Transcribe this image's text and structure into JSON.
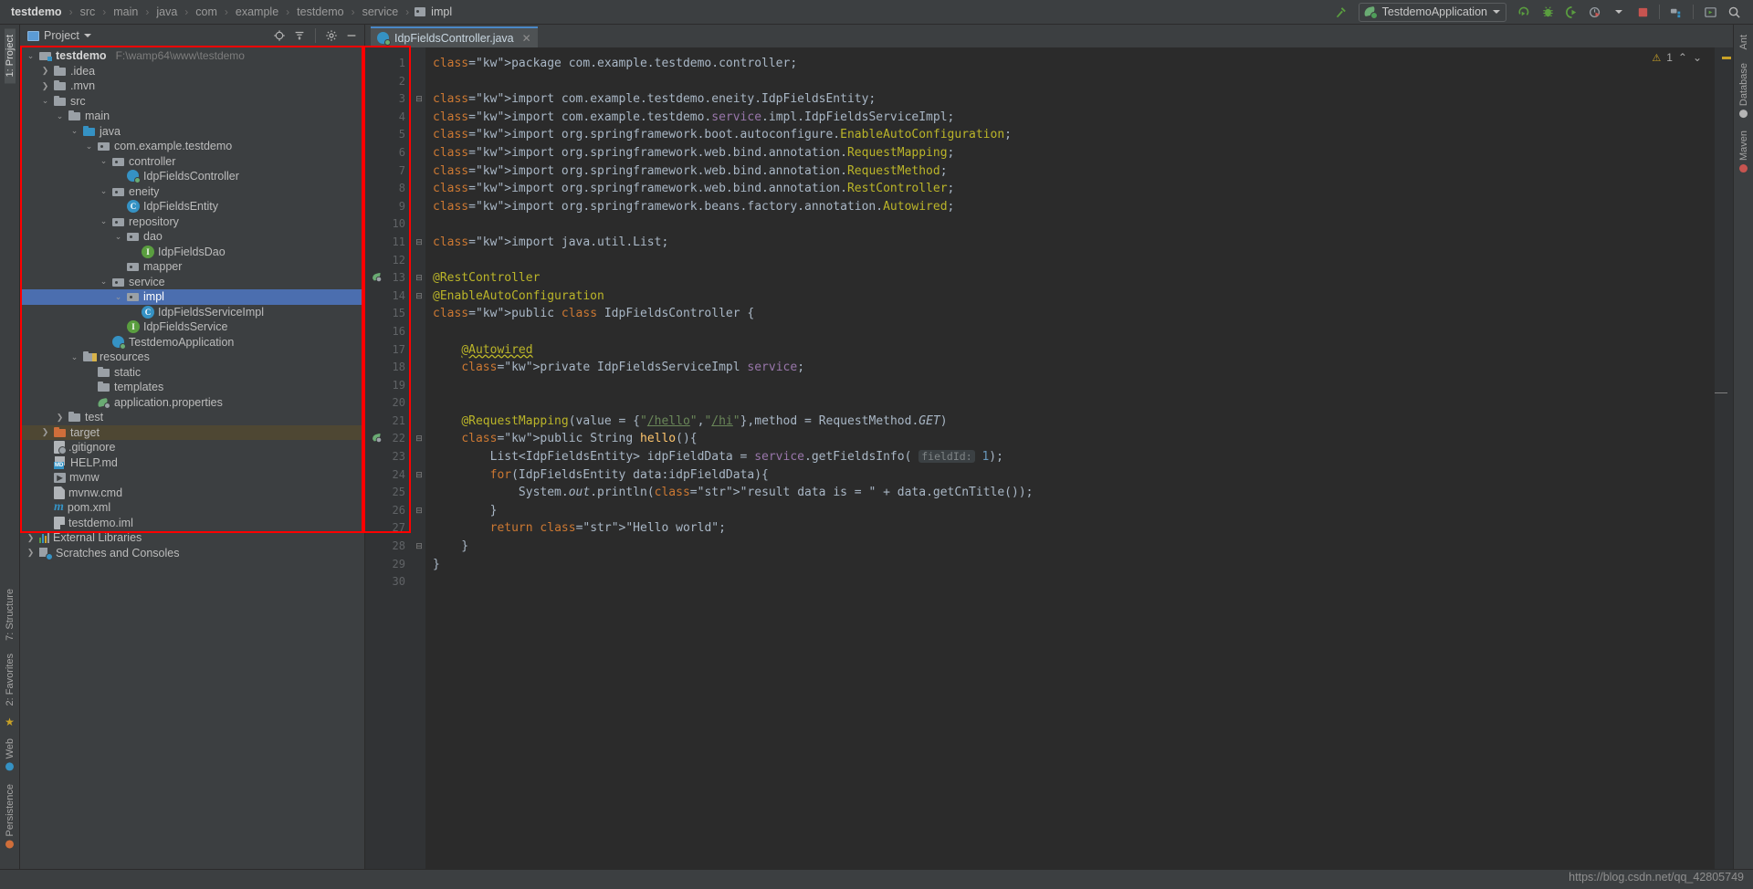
{
  "window": {
    "breadcrumb": [
      "testdemo",
      "src",
      "main",
      "java",
      "com",
      "example",
      "testdemo",
      "service",
      "impl"
    ],
    "breadcrumb_last_icon": "folder-icon"
  },
  "toolbar": {
    "build_icon": "hammer-icon",
    "run_config_name": "TestdemoApplication",
    "run_config_icon": "spring-leaf-icon",
    "dropdown_icon": "chevron-down-icon",
    "run_icon": "run-icon",
    "debug_icon": "debug-bug-icon",
    "run_coverage_icon": "run-coverage-icon",
    "profiler_icon": "profiler-icon",
    "profiler_caret_icon": "chevron-down-icon",
    "stop_icon": "stop-icon",
    "stop_color": "#c75450",
    "project_structure_icon": "project-structure-icon",
    "run_anything_icon": "run-anything-icon",
    "search_icon": "search-everywhere-icon"
  },
  "left_rail": [
    {
      "label": "1: Project",
      "active": true,
      "icon": "project-tool-icon"
    },
    {
      "label": "7: Structure",
      "active": false,
      "icon": "structure-tool-icon"
    },
    {
      "label": "2: Favorites",
      "active": false,
      "icon": "favorites-star-icon"
    },
    {
      "label": "Web",
      "active": false,
      "icon": "web-tool-icon"
    },
    {
      "label": "Persistence",
      "active": false,
      "icon": "persistence-tool-icon"
    }
  ],
  "right_rail": [
    {
      "label": "Ant",
      "icon": "ant-tool-icon"
    },
    {
      "label": "Database",
      "icon": "database-tool-icon"
    },
    {
      "label": "Maven",
      "icon": "maven-tool-icon"
    }
  ],
  "project_panel": {
    "title": "Project",
    "title_caret": "chevron-down-icon",
    "window_icon": "tool-window-icon",
    "tools": [
      {
        "name": "locate-icon",
        "label": "Select Opened File"
      },
      {
        "name": "collapse-all-icon",
        "label": "Collapse All"
      },
      {
        "name": "gear-icon",
        "label": "Settings"
      },
      {
        "name": "minimize-icon",
        "label": "Hide"
      }
    ],
    "tree": [
      {
        "indent": 0,
        "arrow": "down",
        "icon": "project-root-icon",
        "label": "testdemo",
        "bold": true,
        "path": "F:\\wamp64\\www\\testdemo"
      },
      {
        "indent": 1,
        "arrow": "right",
        "icon": "folder-icon",
        "label": ".idea"
      },
      {
        "indent": 1,
        "arrow": "right",
        "icon": "folder-icon",
        "label": ".mvn"
      },
      {
        "indent": 1,
        "arrow": "down",
        "icon": "folder-icon",
        "label": "src"
      },
      {
        "indent": 2,
        "arrow": "down",
        "icon": "folder-icon",
        "label": "main"
      },
      {
        "indent": 3,
        "arrow": "down",
        "icon": "source-folder-icon",
        "label": "java"
      },
      {
        "indent": 4,
        "arrow": "down",
        "icon": "package-icon",
        "label": "com.example.testdemo"
      },
      {
        "indent": 5,
        "arrow": "down",
        "icon": "package-icon",
        "label": "controller"
      },
      {
        "indent": 6,
        "arrow": "none",
        "icon": "spring-class-icon",
        "label": "IdpFieldsController"
      },
      {
        "indent": 5,
        "arrow": "down",
        "icon": "package-icon",
        "label": "eneity"
      },
      {
        "indent": 6,
        "arrow": "none",
        "icon": "class-icon",
        "label": "IdpFieldsEntity"
      },
      {
        "indent": 5,
        "arrow": "down",
        "icon": "package-icon",
        "label": "repository"
      },
      {
        "indent": 6,
        "arrow": "down",
        "icon": "package-icon",
        "label": "dao"
      },
      {
        "indent": 7,
        "arrow": "none",
        "icon": "interface-icon",
        "label": "IdpFieldsDao"
      },
      {
        "indent": 6,
        "arrow": "none",
        "icon": "package-icon",
        "label": "mapper"
      },
      {
        "indent": 5,
        "arrow": "down",
        "icon": "package-icon",
        "label": "service"
      },
      {
        "indent": 6,
        "arrow": "down",
        "icon": "package-icon",
        "label": "impl",
        "selected": true
      },
      {
        "indent": 7,
        "arrow": "none",
        "icon": "class-icon",
        "label": "IdpFieldsServiceImpl"
      },
      {
        "indent": 6,
        "arrow": "none",
        "icon": "interface-icon",
        "label": "IdpFieldsService"
      },
      {
        "indent": 5,
        "arrow": "none",
        "icon": "spring-class-icon",
        "label": "TestdemoApplication"
      },
      {
        "indent": 3,
        "arrow": "down",
        "icon": "resources-folder-icon",
        "label": "resources"
      },
      {
        "indent": 4,
        "arrow": "none",
        "icon": "folder-icon",
        "label": "static"
      },
      {
        "indent": 4,
        "arrow": "none",
        "icon": "folder-icon",
        "label": "templates"
      },
      {
        "indent": 4,
        "arrow": "none",
        "icon": "spring-properties-icon",
        "label": "application.properties"
      },
      {
        "indent": 2,
        "arrow": "right",
        "icon": "folder-icon",
        "label": "test"
      },
      {
        "indent": 1,
        "arrow": "right",
        "icon": "excluded-folder-icon",
        "label": "target",
        "highlighted": true
      },
      {
        "indent": 1,
        "arrow": "none",
        "icon": "gitignore-icon",
        "label": ".gitignore"
      },
      {
        "indent": 1,
        "arrow": "none",
        "icon": "markdown-icon",
        "label": "HELP.md"
      },
      {
        "indent": 1,
        "arrow": "none",
        "icon": "shell-script-icon",
        "label": "mvnw"
      },
      {
        "indent": 1,
        "arrow": "none",
        "icon": "cmd-file-icon",
        "label": "mvnw.cmd"
      },
      {
        "indent": 1,
        "arrow": "none",
        "icon": "maven-pom-icon",
        "label": "pom.xml"
      },
      {
        "indent": 1,
        "arrow": "none",
        "icon": "module-iml-icon",
        "label": "testdemo.iml"
      },
      {
        "indent": 0,
        "arrow": "right",
        "icon": "libraries-icon",
        "label": "External Libraries"
      },
      {
        "indent": 0,
        "arrow": "right",
        "icon": "scratches-icon",
        "label": "Scratches and Consoles"
      }
    ]
  },
  "editor": {
    "tab": {
      "label": "IdpFieldsController.java",
      "icon": "spring-class-icon",
      "close_icon": "close-icon"
    },
    "warning_count": "1",
    "warning_icon": "warning-triangle-icon",
    "prev_problem_icon": "chevron-up-icon",
    "next_problem_icon": "chevron-down-icon",
    "first_line": 1,
    "last_line": 30,
    "line_numbers": [
      1,
      2,
      3,
      4,
      5,
      6,
      7,
      8,
      9,
      10,
      11,
      12,
      13,
      14,
      15,
      16,
      17,
      18,
      19,
      20,
      21,
      22,
      23,
      24,
      25,
      26,
      27,
      28,
      29,
      30
    ],
    "gutter_icons": [
      {
        "line": 13,
        "name": "spring-bean-gutter-icon"
      },
      {
        "line": 22,
        "name": "spring-request-mapping-gutter-icon"
      }
    ],
    "fold_markers": [
      {
        "line": 3,
        "type": "collapse"
      },
      {
        "line": 11,
        "type": "collapse"
      },
      {
        "line": 13,
        "type": "collapse"
      },
      {
        "line": 14,
        "type": "collapse"
      },
      {
        "line": 22,
        "type": "collapse"
      },
      {
        "line": 24,
        "type": "collapse"
      },
      {
        "line": 26,
        "type": "collapse"
      },
      {
        "line": 28,
        "type": "collapse"
      }
    ],
    "code_lines": [
      "package com.example.testdemo.controller;",
      "",
      "import com.example.testdemo.eneity.IdpFieldsEntity;",
      "import com.example.testdemo.service.impl.IdpFieldsServiceImpl;",
      "import org.springframework.boot.autoconfigure.EnableAutoConfiguration;",
      "import org.springframework.web.bind.annotation.RequestMapping;",
      "import org.springframework.web.bind.annotation.RequestMethod;",
      "import org.springframework.web.bind.annotation.RestController;",
      "import org.springframework.beans.factory.annotation.Autowired;",
      "",
      "import java.util.List;",
      "",
      "@RestController",
      "@EnableAutoConfiguration",
      "public class IdpFieldsController {",
      "",
      "    @Autowired",
      "    private IdpFieldsServiceImpl service;",
      "",
      "",
      "    @RequestMapping(value = {\"/hello\",\"/hi\"},method = RequestMethod.GET)",
      "    public String hello(){",
      "        List<IdpFieldsEntity> idpFieldData = service.getFieldsInfo( fieldId: 1);",
      "        for(IdpFieldsEntity data:idpFieldData){",
      "            System.out.println(\"result data is = \" + data.getCnTitle());",
      "        }",
      "        return \"Hello world\";",
      "    }",
      "}",
      ""
    ],
    "inlay_hints": [
      {
        "line": 23,
        "text": "fieldId:"
      }
    ]
  },
  "watermark": "https://blog.csdn.net/qq_42805749",
  "annotations": {
    "red_box_color": "#ff0000",
    "boxes": [
      {
        "name": "project-tree-highlight"
      },
      {
        "name": "editor-gutter-highlight"
      }
    ]
  },
  "colors": {
    "panel_bg": "#3c3f41",
    "editor_bg": "#2b2b2b",
    "gutter_bg": "#313335",
    "selection_blue": "#4b6eaf",
    "tab_active": "#4e5254",
    "accent_blue": "#3592c4",
    "keyword_orange": "#cc7832",
    "annotation_yellow": "#bbb529",
    "string_green": "#6a8759",
    "field_purple": "#9876aa",
    "method_yellow": "#ffc66d",
    "number_blue": "#6897bb"
  }
}
